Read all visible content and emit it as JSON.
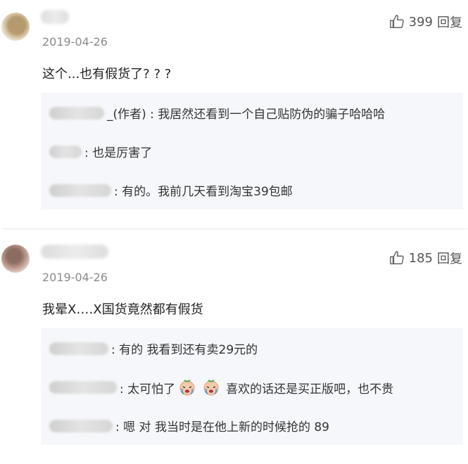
{
  "comments": [
    {
      "date": "2019-04-26",
      "likes": "399",
      "reply_label": "回复",
      "text": "这个...也有假货了? ? ?",
      "replies": [
        {
          "text": "_(作者) : 我居然还看到一个自己贴防伪的骗子哈哈哈"
        },
        {
          "text": ": 也是厉害了"
        },
        {
          "text": ": 有的。我前几天看到淘宝39包邮"
        }
      ]
    },
    {
      "date": "2019-04-26",
      "likes": "185",
      "reply_label": "回复",
      "text": "我晕X‥‥X国货竟然都有假货",
      "replies": [
        {
          "text": ": 有的 我看到还有卖29元的"
        },
        {
          "before": ": 太可怕了",
          "after": "喜欢的话还是买正版吧，也不贵"
        },
        {
          "text": ": 嗯 对 我当时是在他上新的时候抢的 89"
        }
      ]
    }
  ],
  "icons": {
    "like": "thumbs-up-icon",
    "emoji": "crying-face-icon"
  },
  "colors": {
    "date": "#8a8a8a",
    "reply_bg": "#f5f7fa",
    "divider": "#e6e6e6"
  }
}
